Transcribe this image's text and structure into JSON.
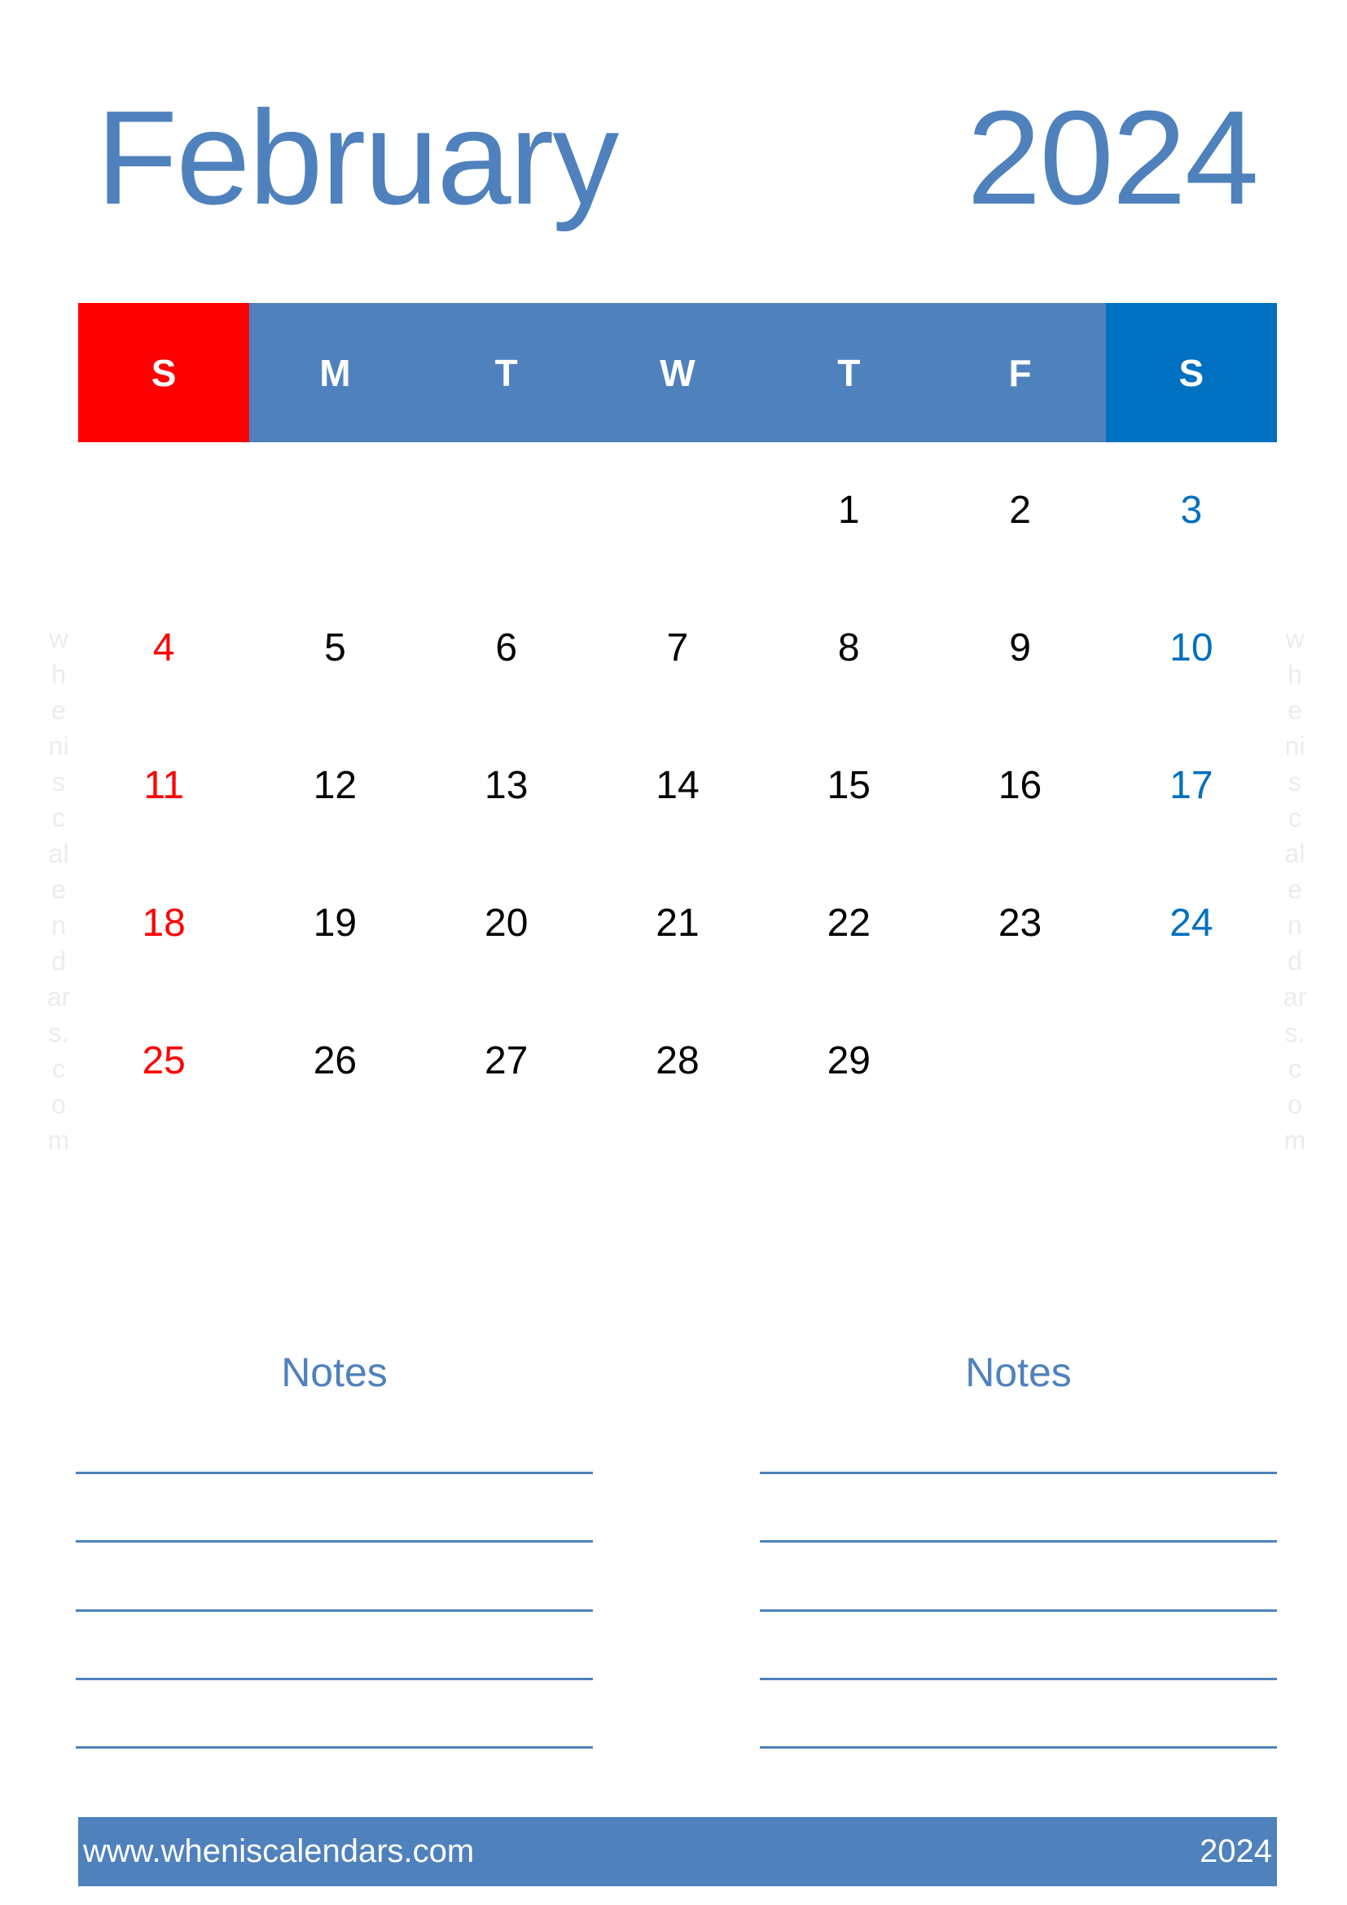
{
  "header": {
    "month": "February",
    "year": "2024"
  },
  "colors": {
    "primary": "#4f81bd",
    "sunday": "#ff0000",
    "saturday": "#0070c0"
  },
  "weekdays": [
    "S",
    "M",
    "T",
    "W",
    "T",
    "F",
    "S"
  ],
  "weeks": [
    [
      "",
      "",
      "",
      "",
      "1",
      "2",
      "3"
    ],
    [
      "4",
      "5",
      "6",
      "7",
      "8",
      "9",
      "10"
    ],
    [
      "11",
      "12",
      "13",
      "14",
      "15",
      "16",
      "17"
    ],
    [
      "18",
      "19",
      "20",
      "21",
      "22",
      "23",
      "24"
    ],
    [
      "25",
      "26",
      "27",
      "28",
      "29",
      "",
      ""
    ]
  ],
  "watermark": [
    "w",
    "h",
    "e",
    "ni",
    "s",
    "c",
    "al",
    "e",
    "n",
    "d",
    "ar",
    "s.",
    "c",
    "o",
    "m"
  ],
  "notes": [
    {
      "title": "Notes",
      "line_count": 5
    },
    {
      "title": "Notes",
      "line_count": 5
    }
  ],
  "footer": {
    "url": "www.wheniscalendars.com",
    "year": "2024"
  }
}
